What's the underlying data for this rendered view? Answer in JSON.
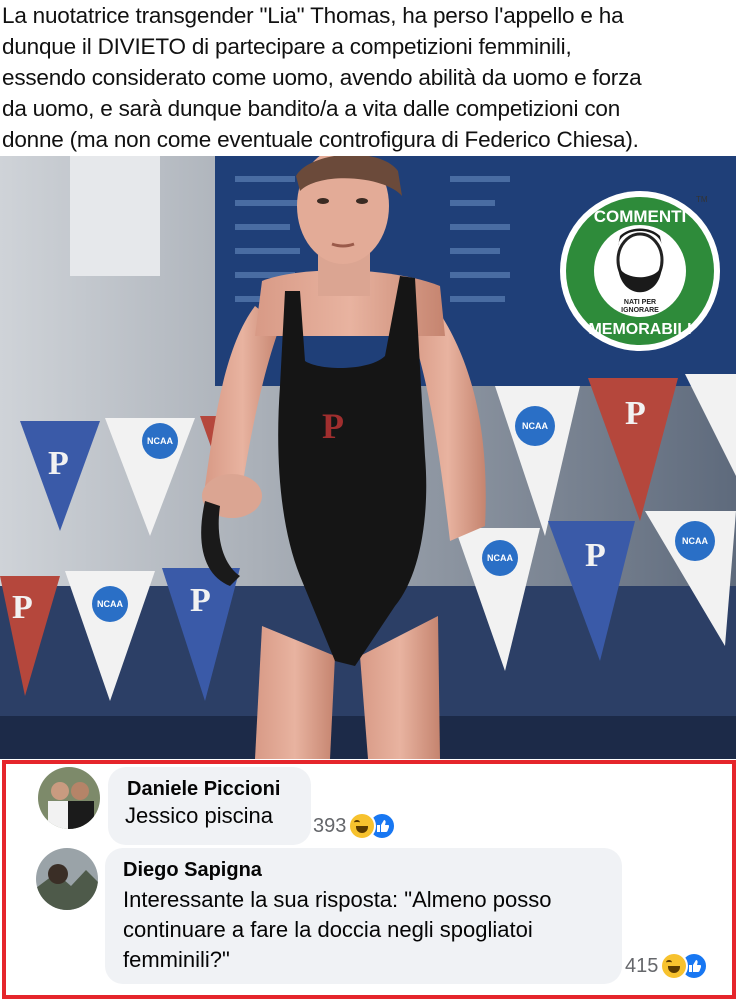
{
  "caption": {
    "lines": [
      "La nuotatrice transgender \"Lia\" Thomas, ha perso l'appello e ha",
      "dunque il DIVIETO di partecipare a competizioni femminili,",
      "essendo considerato come uomo, avendo abilità da uomo e forza",
      "da uomo, e sarà dunque bandito/a a vita dalle competizioni con",
      "donne (ma non come eventuale controfigura di Federico Chiesa)."
    ]
  },
  "photo": {
    "logo": {
      "top_text": "COMMENTI",
      "bottom_text": "MEMORABILI",
      "tagline": [
        "NATI PER",
        "IGNORARE"
      ],
      "trademark": "TM"
    },
    "banner_marks": {
      "letter": "P",
      "badge": "NCAA"
    }
  },
  "comments": [
    {
      "author": "Daniele Piccioni",
      "lines": [
        "Jessico piscina"
      ],
      "reaction_count": "393",
      "reactions": [
        "haha-icon",
        "like-icon"
      ]
    },
    {
      "author": "Diego Sapigna",
      "lines": [
        "Interessante la sua risposta: \"Almeno posso",
        "continuare a fare la doccia negli spogliatoi",
        "femminili?\""
      ],
      "reaction_count": "415",
      "reactions": [
        "haha-icon",
        "like-icon"
      ]
    }
  ],
  "colors": {
    "highlight_border": "#e5252b",
    "logo_green": "#2e8b3a",
    "comment_bubble": "#f0f2f5",
    "like_blue": "#1877f2",
    "haha_yellow": "#f7c22e"
  }
}
